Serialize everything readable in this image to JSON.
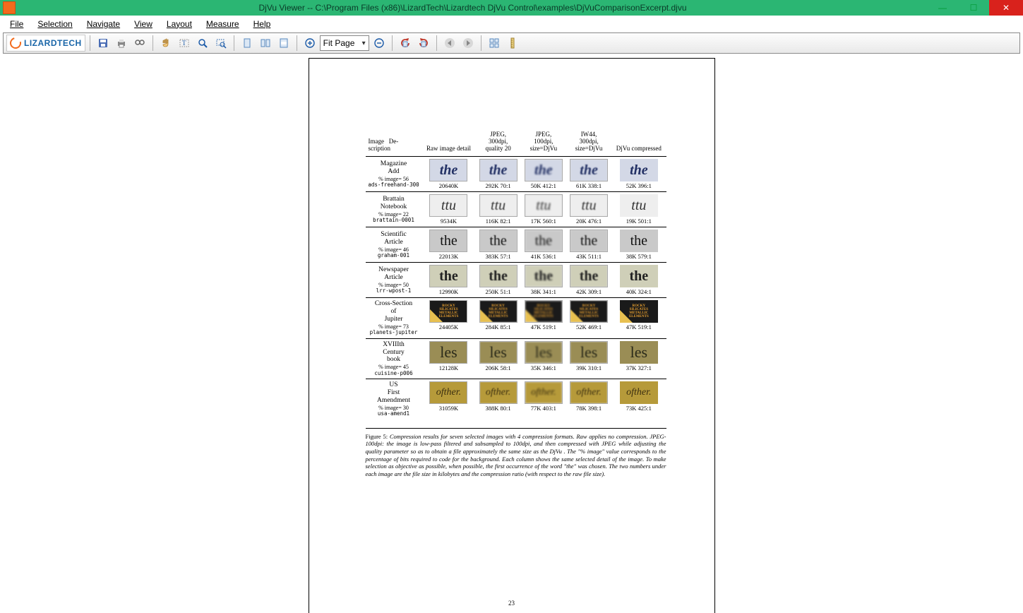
{
  "window": {
    "title": "DjVu Viewer -- C:\\Program Files (x86)\\LizardTech\\Lizardtech DjVu Control\\examples\\DjVuComparisonExcerpt.djvu"
  },
  "menu": {
    "file": "File",
    "selection": "Selection",
    "navigate": "Navigate",
    "view": "View",
    "layout": "Layout",
    "measure": "Measure",
    "help": "Help"
  },
  "brand": "LIZARDTECH",
  "zoom": {
    "value": "Fit Page"
  },
  "doc": {
    "headers": [
      "Image Description",
      "Raw image detail",
      "JPEG, 300dpi, quality 20",
      "JPEG, 100dpi, size=DjVu",
      "IW44, 300dpi, size=DjVu",
      "DjVu compressed"
    ],
    "rows": [
      {
        "name": "Magazine Add",
        "pct": "% image= 56",
        "code": "ads-freehand-300",
        "sample": "the",
        "kind": "the-i",
        "vals": [
          "20640K",
          "292K 70:1",
          "50K 412:1",
          "61K 338:1",
          "52K 396:1"
        ]
      },
      {
        "name": "Brattain Notebook",
        "pct": "% image= 22",
        "code": "brattain-0001",
        "sample": "ttu",
        "kind": "ttu",
        "vals": [
          "9534K",
          "116K 82:1",
          "17K 560:1",
          "20K 476:1",
          "19K 501:1"
        ]
      },
      {
        "name": "Scientific Article",
        "pct": "% image= 46",
        "code": "graham-001",
        "sample": "the",
        "kind": "the-s",
        "vals": [
          "22013K",
          "383K 57:1",
          "41K 536:1",
          "43K 511:1",
          "38K 579:1"
        ]
      },
      {
        "name": "Newspaper Article",
        "pct": "% image= 50",
        "code": "lrr-wpost-1",
        "sample": "the",
        "kind": "the-n",
        "vals": [
          "12990K",
          "250K 51:1",
          "38K 341:1",
          "42K 309:1",
          "40K 324:1"
        ]
      },
      {
        "name": "Cross-Section of Jupiter",
        "pct": "% image= 73",
        "code": "planets-jupiter",
        "sample": "ROCKY SILICATES METALLIC ELEMENTS",
        "kind": "rocky",
        "vals": [
          "24405K",
          "284K 85:1",
          "47K 519:1",
          "52K 469:1",
          "47K 519:1"
        ]
      },
      {
        "name": "XVIIIth Century book",
        "pct": "% image= 45",
        "code": "cuisine-p006",
        "sample": "les",
        "kind": "les",
        "vals": [
          "12128K",
          "206K 58:1",
          "35K 346:1",
          "39K 310:1",
          "37K 327:1"
        ]
      },
      {
        "name": "US First Amendment",
        "pct": "% image= 30",
        "code": "usa-amend1",
        "sample": "ofther.",
        "kind": "ofther",
        "vals": [
          "31059K",
          "388K 80:1",
          "77K 403:1",
          "78K 398:1",
          "73K 425:1"
        ]
      }
    ],
    "caption_label": "Figure 5:",
    "caption": "Compression results for seven selected images with 4 compression formats. Raw applies no compression. JPEG-100dpi: the image is low-pass filtered and subsampled to 100dpi, and then compressed with JPEG while adjusting the quality parameter so as to obtain a file approximately the same size as the DjVu . The \"% image\" value corresponds to the percentage of bits required to code for the background. Each column shows the same selected detail of the image. To make selection as objective as possible, when possible, the first occurrence of the word \"the\" was chosen. The two numbers under each image are the file size in kilobytes and the compression ratio (with respect to the raw file size).",
    "page_number": "23"
  }
}
